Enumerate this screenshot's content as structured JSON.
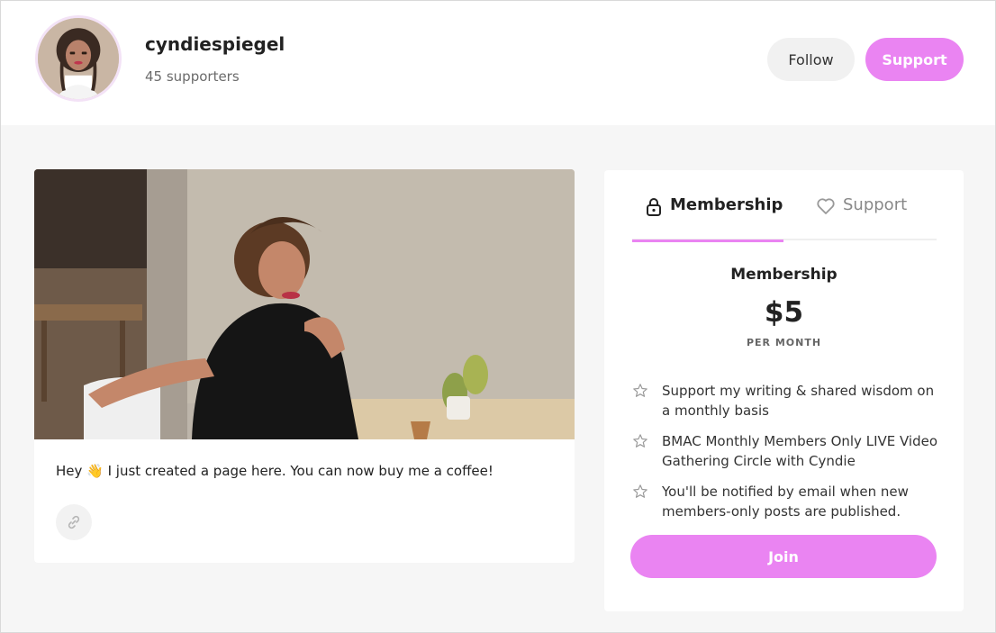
{
  "header": {
    "name": "cyndiespiegel",
    "supporters": "45 supporters",
    "follow_label": "Follow",
    "support_label": "Support"
  },
  "post": {
    "text": "Hey 👋 I just created a page here. You can now buy me a coffee!",
    "link_icon": "link-icon"
  },
  "membership_panel": {
    "tabs": [
      {
        "label": "Membership",
        "icon": "lock-icon",
        "active": true
      },
      {
        "label": "Support",
        "icon": "heart-icon",
        "active": false
      }
    ],
    "tier": {
      "title": "Membership",
      "price": "$5",
      "period": "PER MONTH",
      "benefits": [
        "Support my writing & shared wisdom on a monthly basis",
        "BMAC Monthly Members Only LIVE Video Gathering Circle with Cyndie",
        "You'll be notified by email when new members-only posts are published."
      ],
      "benefit_icon": "star-icon"
    },
    "join_label": "Join"
  },
  "colors": {
    "accent": "#ea84f2",
    "background": "#f6f6f6",
    "card": "#ffffff"
  }
}
